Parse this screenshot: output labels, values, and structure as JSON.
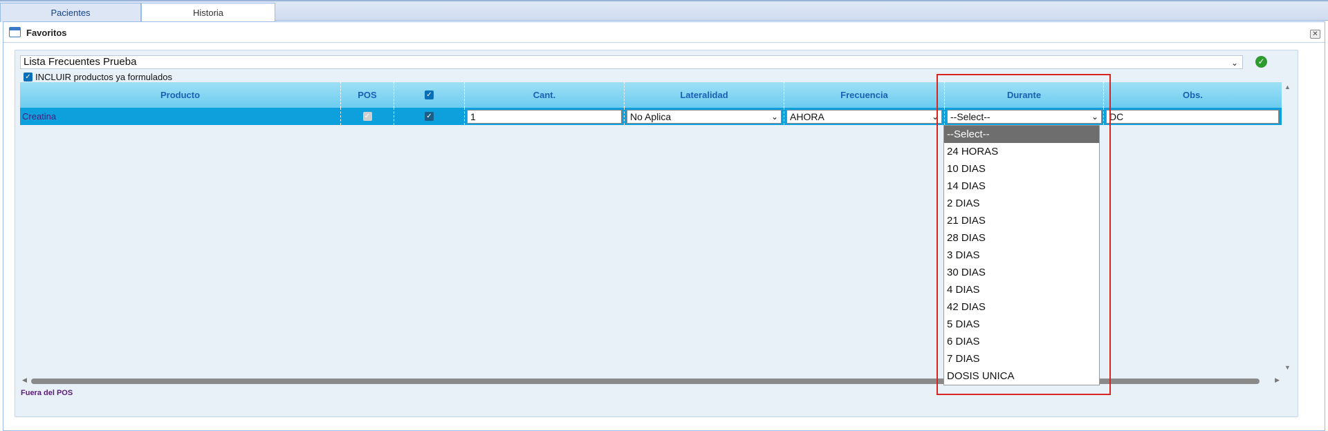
{
  "tabs": [
    {
      "label": "Pacientes"
    },
    {
      "label": "Historia"
    }
  ],
  "panel": {
    "title": "Favoritos",
    "close_icon": "close-icon"
  },
  "list_select": {
    "value": "Lista Frecuentes Prueba"
  },
  "include": {
    "label": "INCLUIR productos ya formulados",
    "checked": true
  },
  "grid": {
    "headers": [
      "Producto",
      "POS",
      "",
      "Cant.",
      "Lateralidad",
      "Frecuencia",
      "Durante",
      "Obs."
    ],
    "row": {
      "producto": "Creatina",
      "pos_checked": true,
      "sel_checked": true,
      "cant": "1",
      "lateralidad": "No Aplica",
      "frecuencia": "AHORA",
      "durante": "--Select--",
      "obs": "DC"
    }
  },
  "footer_note": "Fuera del POS",
  "durante_options": [
    "--Select--",
    "24 HORAS",
    "10 DIAS",
    "14 DIAS",
    "2 DIAS",
    "21 DIAS",
    "28 DIAS",
    "3 DIAS",
    "30 DIAS",
    "4 DIAS",
    "42 DIAS",
    "5 DIAS",
    "6 DIAS",
    "7 DIAS",
    "DOSIS UNICA"
  ],
  "colors": {
    "header": "#6cccef",
    "row_selected": "#0ea0dc",
    "highlight": "#d9231f"
  }
}
